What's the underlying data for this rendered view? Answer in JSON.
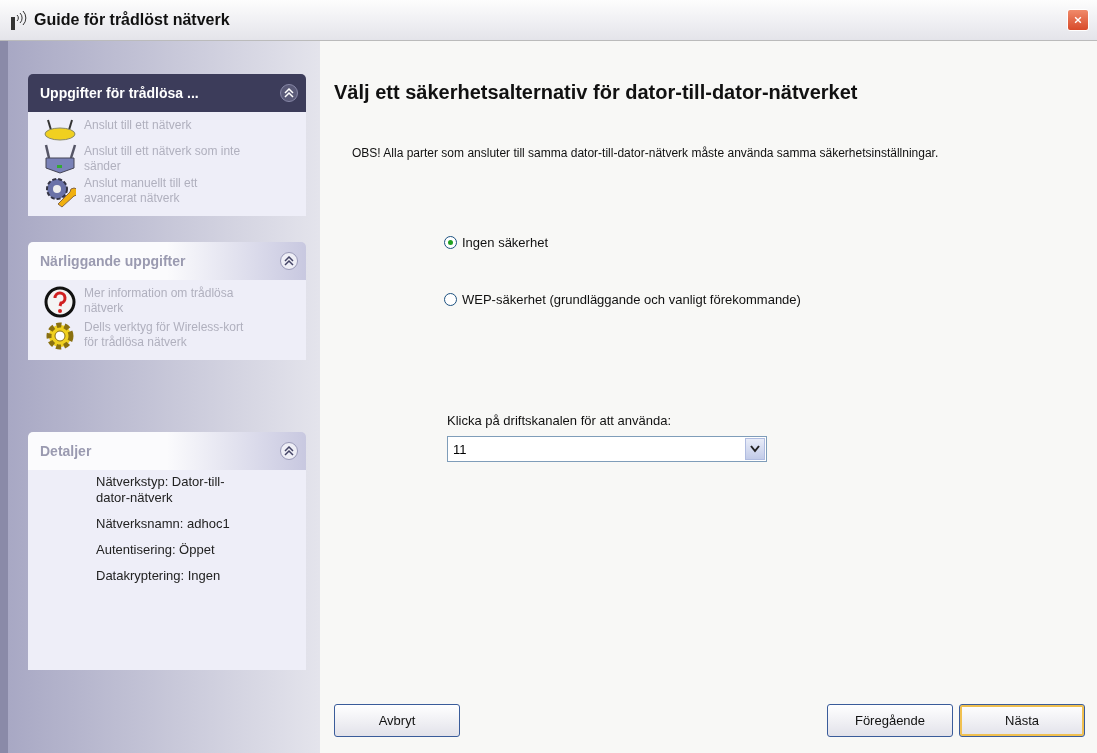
{
  "window": {
    "title": "Guide för trådlöst nätverk"
  },
  "sidebar": {
    "panels": [
      {
        "title": "Uppgifter för trådlösa ...",
        "kind": "special",
        "expanded": true,
        "items": [
          {
            "label": "Anslut till ett nätverk",
            "kind": "router",
            "disabled": true
          },
          {
            "label": "Anslut till ett nätverk som inte sänder",
            "kind": "router2",
            "disabled": true
          },
          {
            "label": "Anslut manuellt till ett avancerat nätverk",
            "kind": "wrench",
            "disabled": true
          }
        ]
      },
      {
        "title": "Närliggande uppgifter",
        "kind": "normal",
        "expanded": true,
        "items": [
          {
            "label": "Mer information om trådlösa nätverk",
            "kind": "help",
            "disabled": true
          },
          {
            "label": "Dells verktyg för Wireless-kort för trådlösa nätverk",
            "kind": "gear",
            "disabled": true
          }
        ]
      },
      {
        "title": "Detaljer",
        "kind": "details",
        "expanded": true,
        "details": [
          "Nätverkstyp: Dator-till-dator-nätverk",
          "Nätverksnamn: adhoc1",
          "Autentisering: Öppet",
          "Datakryptering: Ingen"
        ]
      }
    ]
  },
  "main": {
    "heading": "Välj ett säkerhetsalternativ för dator-till-dator-nätverket",
    "note": "OBS! Alla parter som ansluter till samma dator-till-dator-nätverk måste använda samma säkerhetsinställningar.",
    "options": [
      {
        "label": "Ingen säkerhet",
        "selected": true
      },
      {
        "label": "WEP-säkerhet (grundläggande och vanligt förekommande)",
        "selected": false
      }
    ],
    "channel_label": "Klicka på driftskanalen för att använda:",
    "channel_value": "11"
  },
  "buttons": [
    {
      "label": "Avbryt",
      "default": false
    },
    {
      "label": "Föregående",
      "default": false
    },
    {
      "label": "Nästa",
      "default": true
    }
  ]
}
